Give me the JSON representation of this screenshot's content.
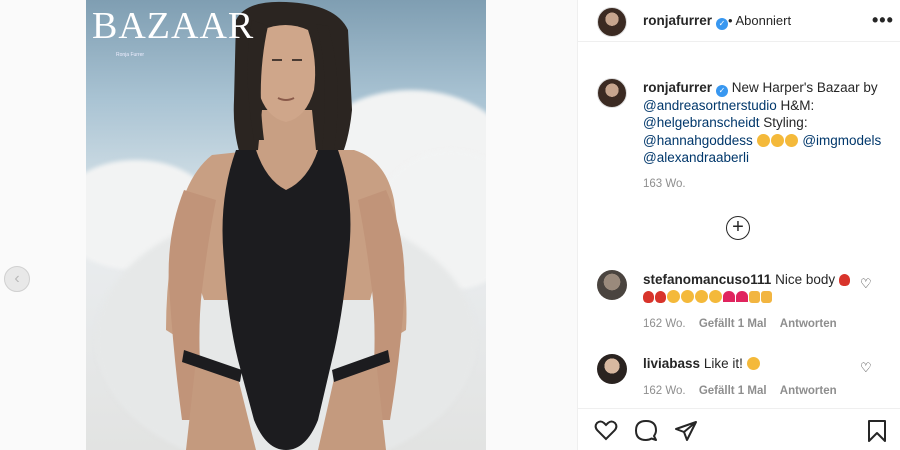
{
  "post": {
    "username": "ronjafurrer",
    "follow_status": "Abonniert",
    "more_icon": "more-options-icon",
    "magazine": {
      "title": "BAZAAR",
      "subtitle": "Ronja Furrer"
    },
    "caption": {
      "username": "ronjafurrer",
      "intro": "New Harper's Bazaar by",
      "mention1": "@andreasortnerstudio",
      "text2": "H&M:",
      "mention2": "@helgebranscheidt",
      "text3": "Styling:",
      "mention3": "@hannahgoddess",
      "mention4": "@imgmodels",
      "mention5": "@alexandraaberli",
      "time": "163 Wo."
    }
  },
  "comments": [
    {
      "username": "stefanomancuso111",
      "text": "Nice body",
      "time": "162 Wo.",
      "likes": "Gefällt 1 Mal",
      "reply": "Antworten"
    },
    {
      "username": "liviabass",
      "text": "Like it!",
      "time": "162 Wo.",
      "likes": "Gefällt 1 Mal",
      "reply": "Antworten"
    }
  ],
  "icons": {
    "like": "heart-icon",
    "comment": "comment-icon",
    "share": "share-icon",
    "save": "bookmark-icon",
    "load_more": "plus-circle-icon",
    "prev": "chevron-left-icon"
  },
  "colors": {
    "link": "#00376b",
    "verified": "#3897f0",
    "meta": "#8e8e8e"
  }
}
